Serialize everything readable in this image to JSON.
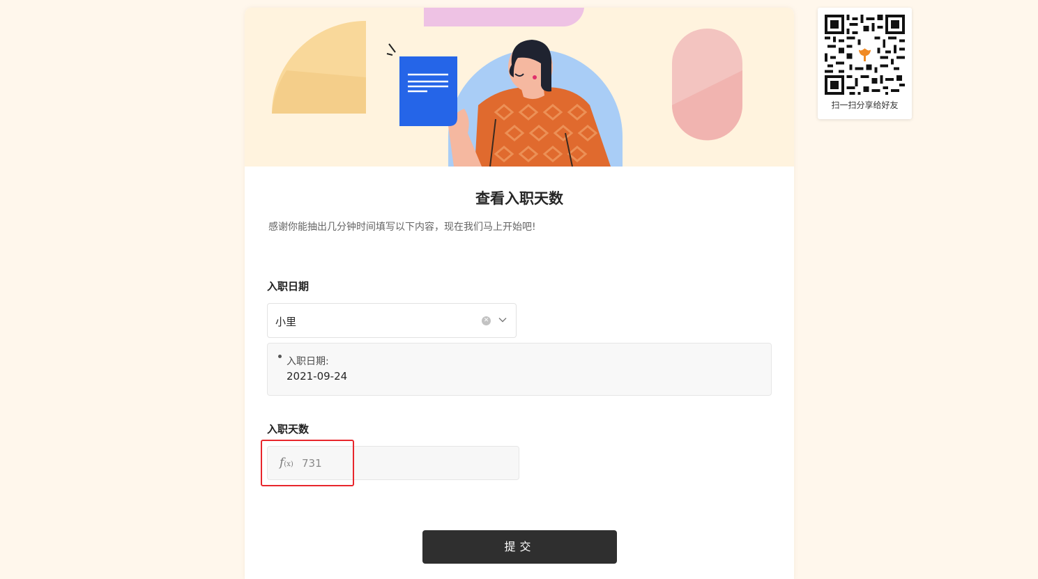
{
  "form": {
    "title": "查看入职天数",
    "description": "感谢你能抽出几分钟时间填写以下内容，现在我们马上开始吧!"
  },
  "fields": {
    "join_date": {
      "label": "入职日期",
      "selected_value": "小里",
      "detail_label": "入职日期:",
      "detail_value": "2021-09-24"
    },
    "join_days": {
      "label": "入职天数",
      "formula_icon": "f(x)",
      "value": "731"
    }
  },
  "submit": {
    "label": "提交"
  },
  "share": {
    "caption": "扫一扫分享给好友"
  },
  "icons": {
    "clear": "clear-icon",
    "dropdown": "chevron-down-icon",
    "formula": "formula-icon",
    "qr": "qr-code-icon"
  },
  "colors": {
    "page_background": "#fff7ec",
    "banner_background": "#fff3de",
    "submit_button": "#2f2f2f",
    "highlight_border": "#e8262c",
    "document_blue": "#2563eb"
  }
}
